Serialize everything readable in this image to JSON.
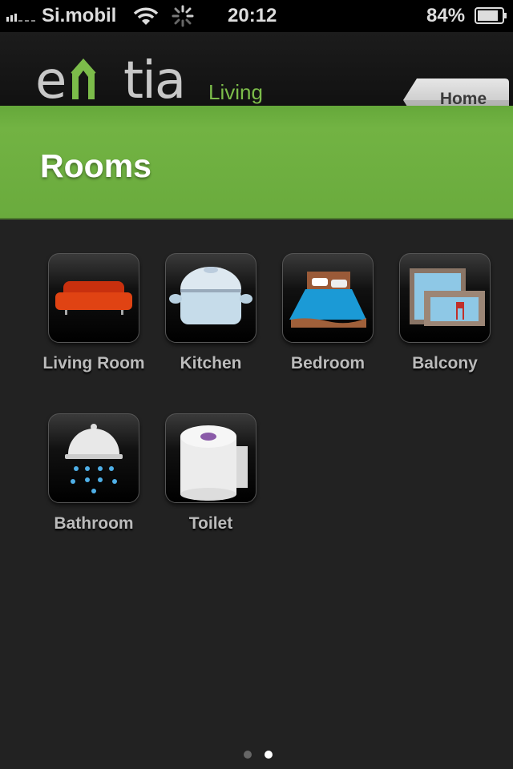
{
  "status_bar": {
    "carrier": "Si.mobil",
    "time": "20:12",
    "battery": "84%",
    "battery_level": 84,
    "signal_icon": "signal-bars-icon",
    "wifi_icon": "wifi-icon",
    "activity_icon": "spinner-icon"
  },
  "header": {
    "logo_text": "entia",
    "logo_sub": "Living",
    "home_label": "Home"
  },
  "banner": {
    "title": "Rooms"
  },
  "rooms": [
    {
      "label": "Living Room",
      "icon": "sofa-icon"
    },
    {
      "label": "Kitchen",
      "icon": "pot-icon"
    },
    {
      "label": "Bedroom",
      "icon": "bed-icon"
    },
    {
      "label": "Balcony",
      "icon": "balcony-icon"
    },
    {
      "label": "Bathroom",
      "icon": "shower-icon"
    },
    {
      "label": "Toilet",
      "icon": "toilet-paper-icon"
    }
  ],
  "pagination": {
    "pages": 2,
    "current": 2
  },
  "colors": {
    "accent": "#6aab3d",
    "background": "#222222"
  }
}
